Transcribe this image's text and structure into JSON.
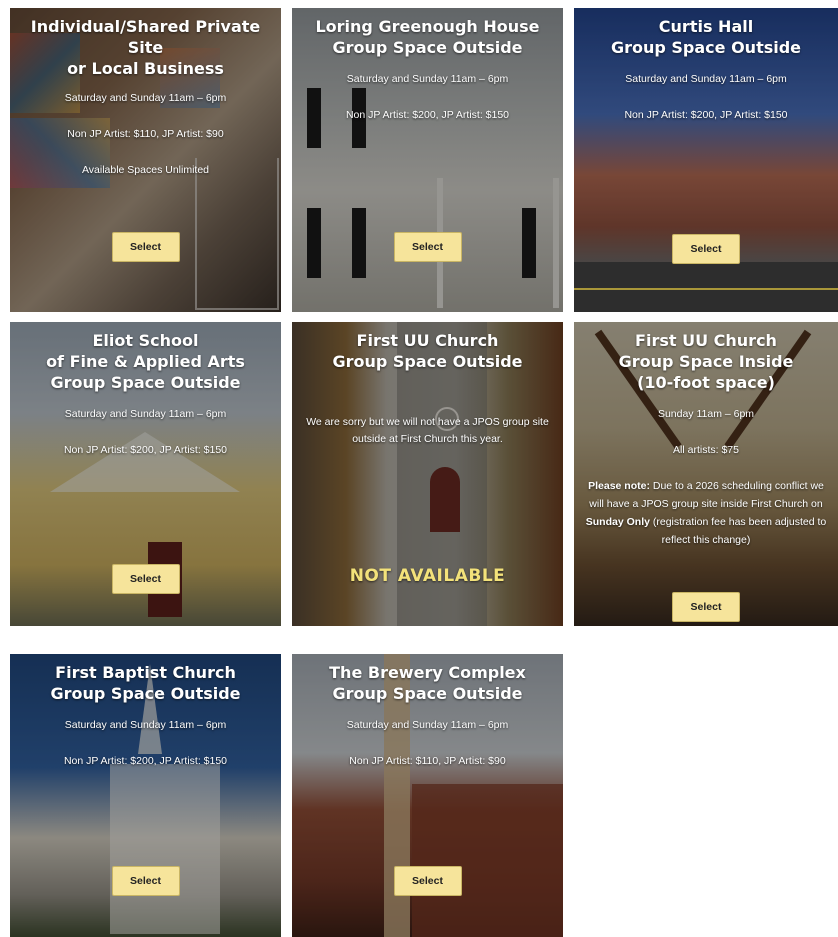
{
  "cards": [
    {
      "title": [
        "Individual/Shared Private",
        "Site",
        "or Local Business"
      ],
      "lines": [
        "Saturday and Sunday 11am – 6pm",
        "Non JP Artist: $110, JP Artist: $90",
        "Available Spaces Unlimited"
      ],
      "button": "Select"
    },
    {
      "title": [
        "Loring Greenough House",
        "Group Space Outside"
      ],
      "lines": [
        "Saturday and Sunday 11am – 6pm",
        "Non JP Artist: $200, JP Artist: $150"
      ],
      "button": "Select"
    },
    {
      "title": [
        "Curtis Hall",
        "Group Space Outside"
      ],
      "lines": [
        "Saturday and Sunday 11am – 6pm",
        "Non JP Artist: $200, JP Artist: $150"
      ],
      "button": "Select"
    },
    {
      "title": [
        "Eliot School",
        "of Fine & Applied Arts",
        "Group Space Outside"
      ],
      "lines": [
        "Saturday and Sunday 11am – 6pm",
        "Non JP Artist: $200, JP Artist: $150"
      ],
      "button": "Select"
    },
    {
      "title": [
        "First UU Church",
        "Group Space Outside"
      ],
      "lines": [
        "We are sorry but we will not have a JPOS group site outside at First Church this year."
      ],
      "status": "NOT AVAILABLE"
    },
    {
      "title": [
        "First UU Church",
        "Group Space Inside",
        "(10-foot space)"
      ],
      "lines": [
        "Sunday 11am – 6pm",
        "All artists: $75"
      ],
      "note": {
        "label": "Please note:",
        "text1": " Due to a 2026 scheduling conflict we will have a JPOS group site inside First Church on ",
        "bold2": "Sunday Only",
        "text2": " (registration fee has been adjusted to reflect this change)"
      },
      "button": "Select"
    },
    {
      "title": [
        "First Baptist Church",
        "Group Space Outside"
      ],
      "lines": [
        "Saturday and Sunday 11am – 6pm",
        "Non JP Artist: $200, JP Artist: $150"
      ],
      "button": "Select"
    },
    {
      "title": [
        "The Brewery Complex",
        "Group Space Outside"
      ],
      "lines": [
        "Saturday and Sunday 11am – 6pm",
        "Non JP Artist: $110, JP Artist: $90"
      ],
      "button": "Select"
    }
  ],
  "colors": {
    "button": "#f6e49b",
    "not_available": "#f3e27a"
  }
}
